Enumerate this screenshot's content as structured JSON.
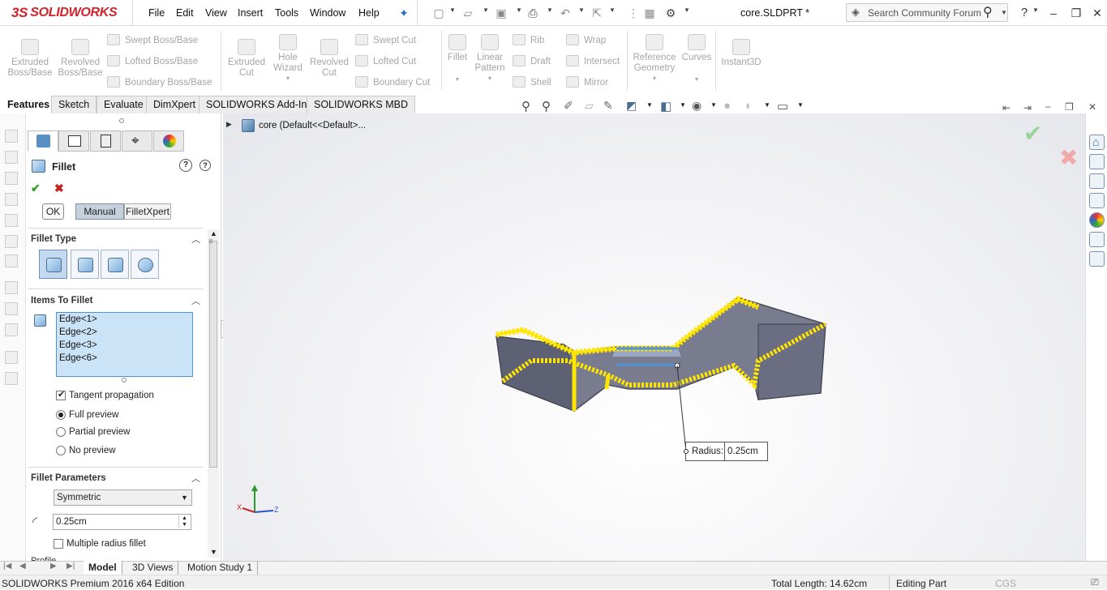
{
  "app": {
    "logo_text": "SOLIDWORKS",
    "logo_mark": "3S",
    "doc_title": "core.SLDPRT *"
  },
  "menu": [
    "File",
    "Edit",
    "View",
    "Insert",
    "Tools",
    "Window",
    "Help"
  ],
  "search": {
    "placeholder": "Search Community Forum"
  },
  "commands": {
    "extruded_boss": "Extruded\nBoss/Base",
    "revolved_boss": "Revolved\nBoss/Base",
    "swept_boss": "Swept Boss/Base",
    "lofted_boss": "Lofted Boss/Base",
    "boundary_boss": "Boundary Boss/Base",
    "extruded_cut": "Extruded\nCut",
    "hole_wizard": "Hole\nWizard",
    "revolved_cut": "Revolved\nCut",
    "swept_cut": "Swept Cut",
    "lofted_cut": "Lofted Cut",
    "boundary_cut": "Boundary Cut",
    "fillet": "Fillet",
    "linear_pattern": "Linear\nPattern",
    "rib": "Rib",
    "draft": "Draft",
    "shell": "Shell",
    "wrap": "Wrap",
    "intersect": "Intersect",
    "mirror": "Mirror",
    "reference_geometry": "Reference\nGeometry",
    "curves": "Curves",
    "instant3d": "Instant3D"
  },
  "tabs": [
    "Features",
    "Sketch",
    "Evaluate",
    "DimXpert",
    "SOLIDWORKS Add-Ins",
    "SOLIDWORKS MBD"
  ],
  "tree": {
    "root": "core  (Default<<Default>..."
  },
  "property_manager": {
    "title": "Fillet",
    "ok": "OK",
    "mode_manual": "Manual",
    "mode_filletxpert": "FilletXpert",
    "fillet_type_header": "Fillet Type",
    "items_header": "Items To Fillet",
    "edges": [
      "Edge<1>",
      "Edge<2>",
      "Edge<3>",
      "Edge<6>"
    ],
    "tangent_propagation": "Tangent propagation",
    "tangent_checked": true,
    "preview_options": [
      "Full preview",
      "Partial preview",
      "No preview"
    ],
    "preview_selected": "Full preview",
    "params_header": "Fillet Parameters",
    "symmetry": "Symmetric",
    "radius": "0.25cm",
    "multiple_radius": "Multiple radius fillet",
    "profile_partial": "Profile"
  },
  "callout": {
    "label": "Radius:",
    "value": "0.25cm"
  },
  "bottom_tabs": [
    "Model",
    "3D Views",
    "Motion Study 1"
  ],
  "status": {
    "edition": "SOLIDWORKS Premium 2016 x64 Edition",
    "total_length": "Total Length: 14.62cm",
    "mode": "Editing Part",
    "units": "CGS"
  },
  "colors": {
    "accent_yellow": "#ffe600",
    "selection_blue": "#4e93d6",
    "body_gray": "#6d6f86",
    "logo_red": "#d3222a"
  }
}
